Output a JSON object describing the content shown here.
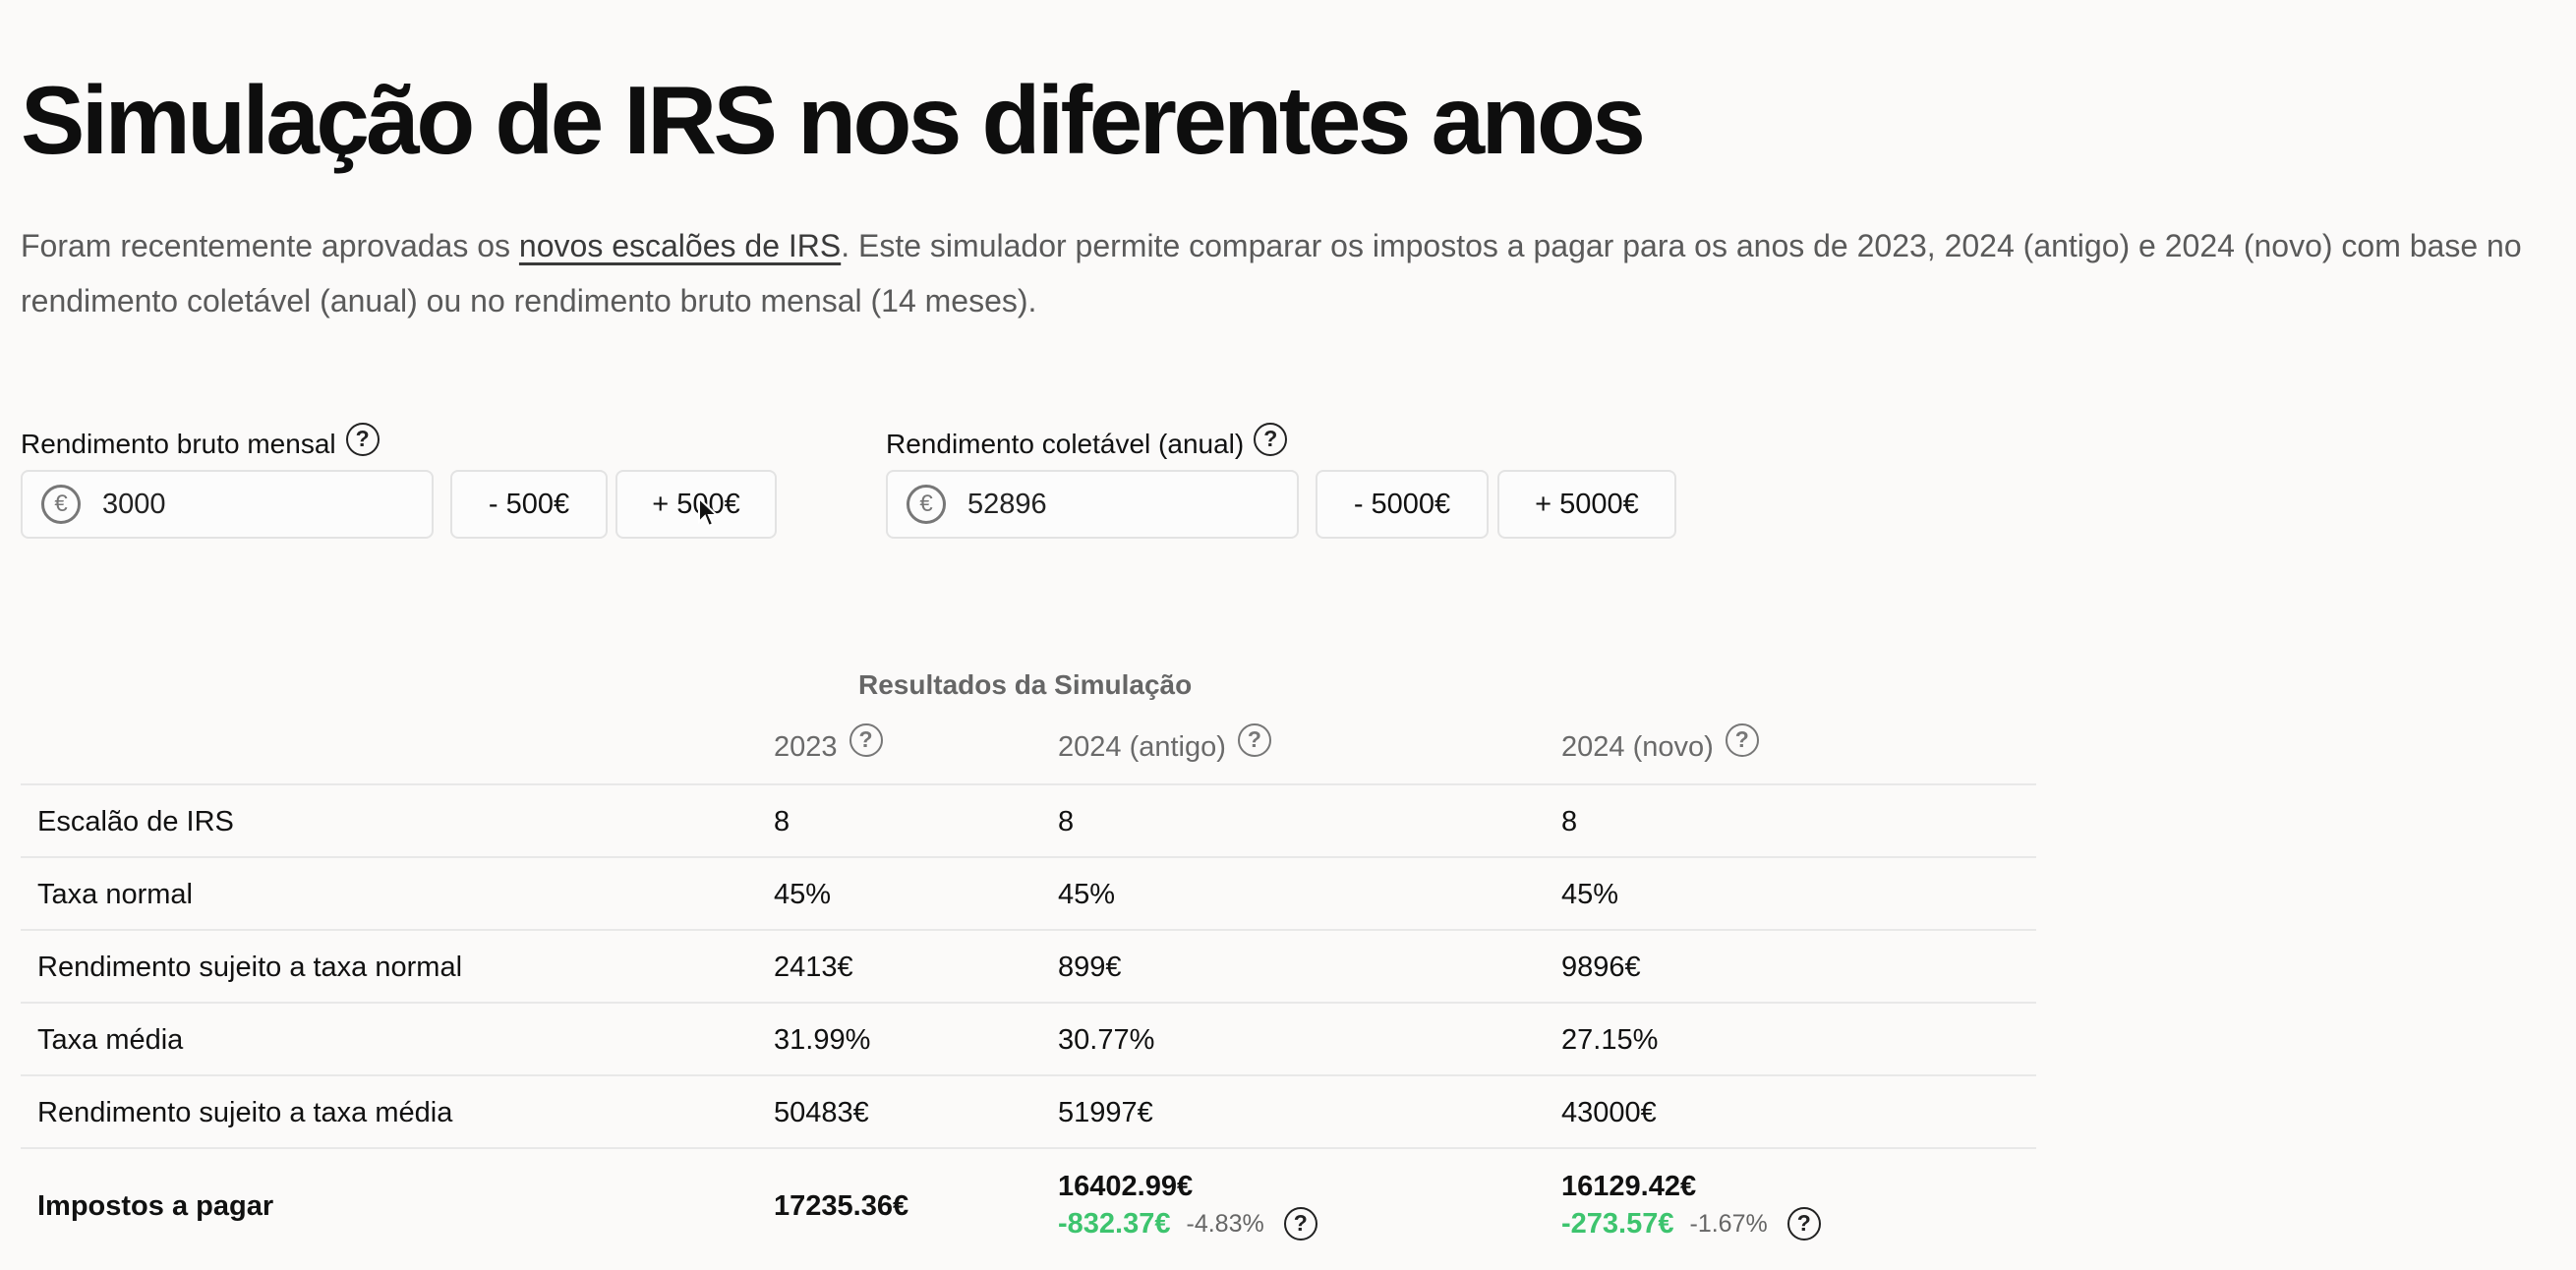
{
  "page": {
    "title": "Simulação de IRS nos diferentes anos",
    "intro_before": "Foram recentemente aprovadas os ",
    "intro_link": "novos escalões de IRS",
    "intro_after": ". Este simulador permite comparar os impostos a pagar para os anos de 2023, 2024 (antigo) e 2024 (novo) com base no rendimento coletável (anual) ou no rendimento bruto mensal (14 meses)."
  },
  "inputs": {
    "gross": {
      "label": "Rendimento bruto mensal",
      "value": "3000",
      "minus_label": "- 500€",
      "plus_label": "+ 500€",
      "currency_icon": "€"
    },
    "taxable": {
      "label": "Rendimento coletável (anual)",
      "value": "52896",
      "minus_label": "- 5000€",
      "plus_label": "+ 5000€",
      "currency_icon": "€"
    },
    "help_glyph": "?"
  },
  "results": {
    "title": "Resultados da Simulação",
    "columns": [
      "2023",
      "2024 (antigo)",
      "2024 (novo)"
    ],
    "rows": [
      {
        "label": "Escalão de IRS",
        "values": [
          "8",
          "8",
          "8"
        ]
      },
      {
        "label": "Taxa normal",
        "values": [
          "45%",
          "45%",
          "45%"
        ]
      },
      {
        "label": "Rendimento sujeito a taxa normal",
        "values": [
          "2413€",
          "899€",
          "9896€"
        ]
      },
      {
        "label": "Taxa média",
        "values": [
          "31.99%",
          "30.77%",
          "27.15%"
        ]
      },
      {
        "label": "Rendimento sujeito a taxa média",
        "values": [
          "50483€",
          "51997€",
          "43000€"
        ]
      }
    ],
    "total": {
      "label": "Impostos a pagar",
      "values": [
        "17235.36€",
        "16402.99€",
        "16129.42€"
      ],
      "deltas": [
        {
          "abs": "-832.37€",
          "pct": "-4.83%"
        },
        {
          "abs": "-273.57€",
          "pct": "-1.67%"
        }
      ]
    },
    "positive_color": "#3dc46e"
  }
}
